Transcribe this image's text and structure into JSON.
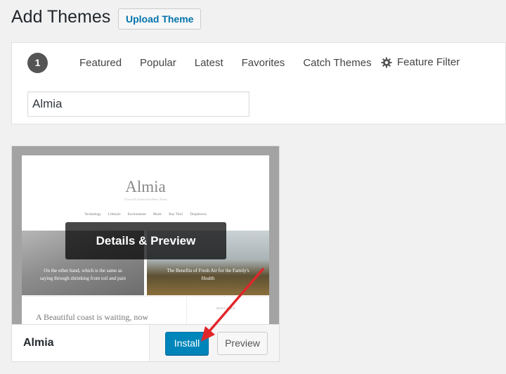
{
  "header": {
    "title": "Add Themes",
    "upload_label": "Upload Theme"
  },
  "filters": {
    "count": "1",
    "links": [
      "Featured",
      "Popular",
      "Latest",
      "Favorites",
      "Catch Themes"
    ],
    "feature_filter": "Feature Filter",
    "gear_icon": "gear-icon"
  },
  "search": {
    "value": "Almia"
  },
  "theme": {
    "name": "Almia",
    "overlay_label": "Details & Preview",
    "install_label": "Install",
    "preview_label": "Preview",
    "screenshot": {
      "site_title": "Almia",
      "tagline": "A Travel & Fashion WordPress Theme",
      "nav": [
        "Technology",
        "Lifestyle",
        "Environment",
        "Music",
        "Buy This!",
        "Dropdowns"
      ],
      "caption_left": "On the other hand, which is the same as saying through shrinking from toil and pain",
      "caption_right": "The Benefits of Fresh Air for the Family's Health",
      "quote": "A Beautiful coast is waiting, now",
      "side_text": "ABOUT ALMIA"
    }
  },
  "colors": {
    "install": "#0085ba",
    "link": "#0073aa",
    "annotation_arrow": "#e0262b"
  }
}
